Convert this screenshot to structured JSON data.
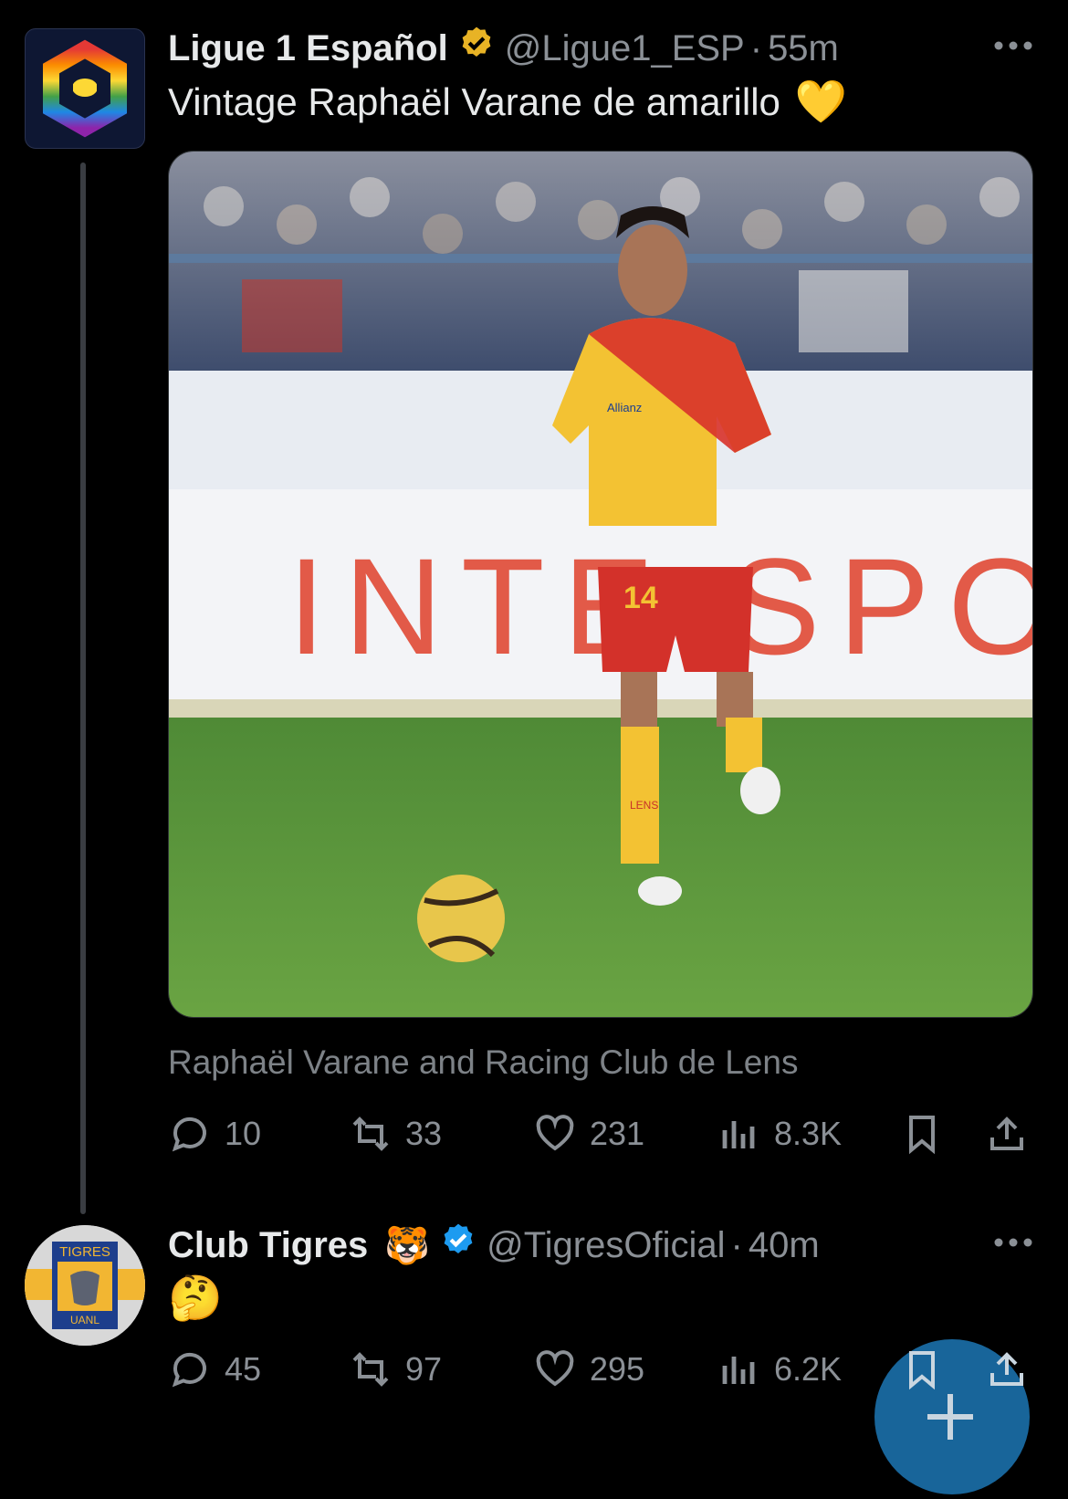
{
  "tweets": [
    {
      "author_name": "Ligue 1 Español",
      "handle": "@Ligue1_ESP",
      "time": "55m",
      "separator": "·",
      "text": "Vintage Raphaël Varane de amarillo",
      "text_emoji": "💛",
      "verified": "gold",
      "media_caption": "Raphaël Varane and Racing Club de Lens",
      "media_text": {
        "banner": "INTE SPO",
        "shirt_number": "14",
        "shirt_sponsor": "Allianz",
        "sock_text": "LENS"
      },
      "stats": {
        "replies": "10",
        "retweets": "33",
        "likes": "231",
        "views": "8.3K"
      }
    },
    {
      "author_name": "Club Tigres",
      "name_emoji": "🐯",
      "handle": "@TigresOficial",
      "time": "40m",
      "separator": "·",
      "text": "🤔",
      "verified": "blue",
      "avatar_text": {
        "top": "TIGRES",
        "bottom": "UANL"
      },
      "stats": {
        "replies": "45",
        "retweets": "97",
        "likes": "295",
        "views": "6.2K"
      }
    }
  ],
  "colors": {
    "background": "#000000",
    "primary_text": "#e7e9ea",
    "secondary_text": "#8b9096",
    "gold_badge": "#e8b325",
    "blue_badge": "#1d9bf0",
    "fab": "#1b6ea8"
  },
  "icons": [
    "more-icon",
    "reply-icon",
    "retweet-icon",
    "like-icon",
    "views-icon",
    "bookmark-icon",
    "share-icon",
    "compose-plus-icon",
    "verified-gold-icon",
    "verified-blue-icon"
  ]
}
